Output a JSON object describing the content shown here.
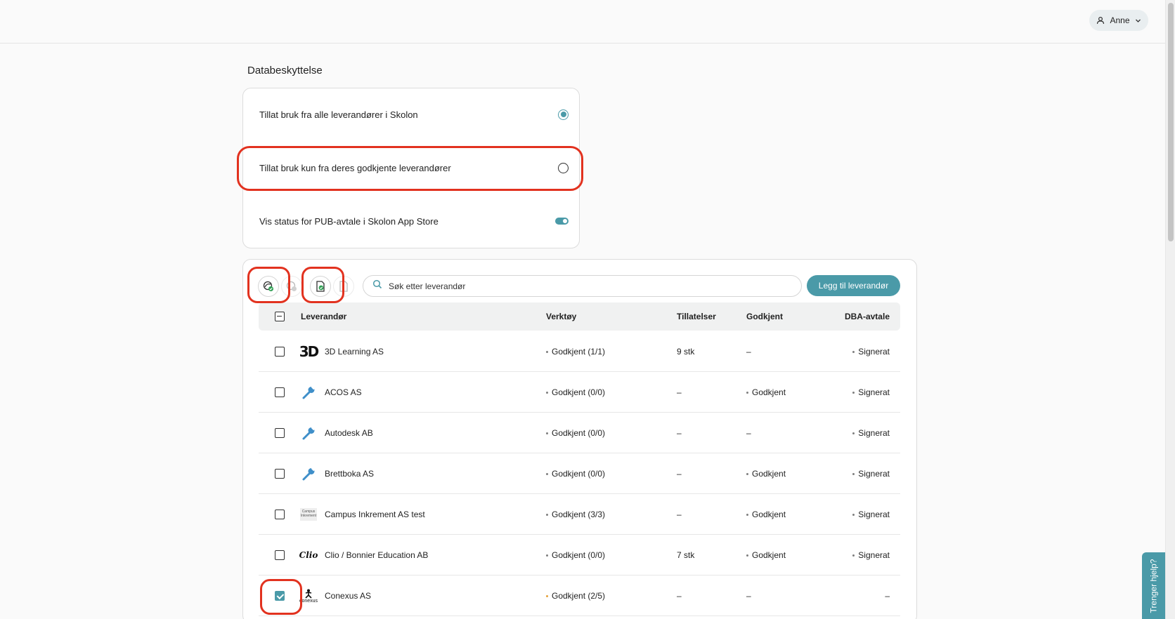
{
  "header": {
    "user_name": "Anne",
    "user_icon": "user-icon",
    "menu_icon": "chevron-down-icon"
  },
  "section": {
    "title": "Databeskyttelse"
  },
  "settings": [
    {
      "label": "Tillat bruk fra alle leverandører i Skolon",
      "control": "radio",
      "selected": true
    },
    {
      "label": "Tillat bruk kun fra deres godkjente leverandører",
      "control": "radio",
      "selected": false
    },
    {
      "label": "Vis status for PUB-avtale i Skolon App Store",
      "control": "toggle",
      "on": true
    }
  ],
  "toolbar": {
    "search_placeholder": "Søk etter leverandør",
    "add_label": "Legg til leverandør",
    "icons": [
      "approve-supplier-icon",
      "approve-supplier-icon-disabled",
      "approve-document-icon",
      "approve-document-icon-disabled"
    ]
  },
  "table": {
    "headers": {
      "supplier": "Leverandør",
      "tools": "Verktøy",
      "permissions": "Tillatelser",
      "approved": "Godkjent",
      "dpa": "DBA-avtale"
    },
    "rows": [
      {
        "logo": "3D",
        "name": "3D Learning AS",
        "tools": "Godkjent (1/1)",
        "permissions": "9 stk",
        "approved": "–",
        "dpa": "Signerat",
        "checked": false
      },
      {
        "logo": "wrench",
        "name": "ACOS AS",
        "tools": "Godkjent (0/0)",
        "permissions": "–",
        "approved": "Godkjent",
        "dpa": "Signerat",
        "checked": false
      },
      {
        "logo": "wrench",
        "name": "Autodesk AB",
        "tools": "Godkjent (0/0)",
        "permissions": "–",
        "approved": "–",
        "dpa": "Signerat",
        "checked": false
      },
      {
        "logo": "wrench",
        "name": "Brettboka AS",
        "tools": "Godkjent (0/0)",
        "permissions": "–",
        "approved": "Godkjent",
        "dpa": "Signerat",
        "checked": false
      },
      {
        "logo": "Campus Inkrement",
        "name": "Campus Inkrement AS test",
        "tools": "Godkjent (3/3)",
        "permissions": "–",
        "approved": "Godkjent",
        "dpa": "Signerat",
        "checked": false
      },
      {
        "logo": "Clio",
        "name": "Clio / Bonnier Education AB",
        "tools": "Godkjent (0/0)",
        "permissions": "7 stk",
        "approved": "Godkjent",
        "dpa": "Signerat",
        "checked": false
      },
      {
        "logo": "conexus",
        "name": "Conexus AS",
        "tools": "Godkjent (2/5)",
        "permissions": "–",
        "approved": "–",
        "dpa": "–",
        "checked": true
      }
    ]
  },
  "help": {
    "label": "Trenger hjelp?"
  },
  "colors": {
    "accent": "#4a9aa8",
    "annotation": "#e2321f",
    "warning": "#e6a23c"
  }
}
